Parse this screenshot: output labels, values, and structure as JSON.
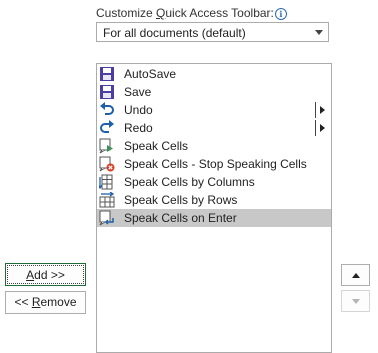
{
  "toolbar_section": {
    "label_prefix": "Customize ",
    "label_accel": "Q",
    "label_suffix": "uick Access Toolbar:",
    "info_glyph": "i"
  },
  "scope_dropdown": {
    "selected": "For all documents (default)"
  },
  "commands": [
    {
      "label": "AutoSave",
      "icon": "save-disk-icon",
      "submenu": false,
      "selected": false
    },
    {
      "label": "Save",
      "icon": "save-disk-icon",
      "submenu": false,
      "selected": false
    },
    {
      "label": "Undo",
      "icon": "undo-icon",
      "submenu": true,
      "selected": false
    },
    {
      "label": "Redo",
      "icon": "redo-icon",
      "submenu": true,
      "selected": false
    },
    {
      "label": "Speak Cells",
      "icon": "speak-cells-icon",
      "submenu": false,
      "selected": false
    },
    {
      "label": "Speak Cells - Stop Speaking Cells",
      "icon": "stop-speaking-icon",
      "submenu": false,
      "selected": false
    },
    {
      "label": "Speak Cells by Columns",
      "icon": "speak-columns-icon",
      "submenu": false,
      "selected": false
    },
    {
      "label": "Speak Cells by Rows",
      "icon": "speak-rows-icon",
      "submenu": false,
      "selected": false
    },
    {
      "label": "Speak Cells on Enter",
      "icon": "speak-enter-icon",
      "submenu": false,
      "selected": true
    }
  ],
  "buttons": {
    "add_accel": "A",
    "add_rest": "dd >>",
    "remove_prefix": "<< ",
    "remove_accel": "R",
    "remove_rest": "emove"
  },
  "colors": {
    "save_blue": "#4a3fa0",
    "arrow_blue": "#1e5fa8",
    "stop_red": "#d4412b",
    "speak_green": "#3f8f5a",
    "selection_gray": "#c8c8c8"
  }
}
